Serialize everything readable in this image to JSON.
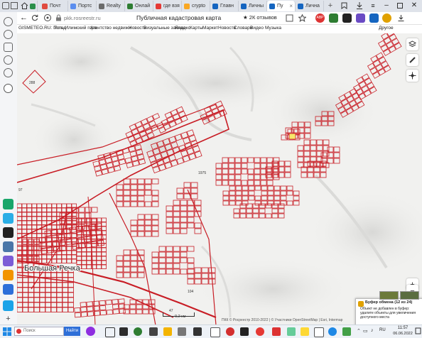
{
  "tabs": [
    {
      "label": "Почт",
      "color": "#e04a3f"
    },
    {
      "label": "Портс",
      "color": "#5b8def"
    },
    {
      "label": "Realty",
      "color": "#6b6b6b"
    },
    {
      "label": "Онлай",
      "color": "#2e7d32"
    },
    {
      "label": "где взя",
      "color": "#e53935"
    },
    {
      "label": "crypto",
      "color": "#f9a825"
    },
    {
      "label": "Главн",
      "color": "#1565c0"
    },
    {
      "label": "Личны",
      "color": "#1565c0"
    },
    {
      "label": "Пу",
      "color": "#1565c0"
    },
    {
      "label": "Лична",
      "color": "#1565c0"
    }
  ],
  "browser": {
    "url": "pkk.rosreestr.ru",
    "page_title": "Публичная кадастровая карта",
    "reviews": "★ 2К отзывов",
    "abp": "ABP"
  },
  "bookmarks": [
    "GISMETEO.RU: Погод",
    "Усть-Илимский горо",
    "Агентство недвижи",
    "Новости",
    "Визуальные заклад",
    "Яндекс",
    "Карты",
    "Маркет",
    "Новости",
    "Словари",
    "Видео",
    "Музыка",
    "Другое"
  ],
  "map": {
    "labels": {
      "town": "Большая Речка",
      "scale": "0,2 км",
      "parcel_288": "288",
      "parcel_1975": "1975",
      "parcel_104": "104",
      "parcel_97": "97",
      "parcel_47": "47",
      "attribution": "ПКК © Росреестр 2010-2022 | © Участники OpenStreetMap | Esri, Intermap"
    },
    "controls": [
      "layers-icon",
      "ruler-icon",
      "locate-icon",
      "zoom-in",
      "zoom-out"
    ],
    "zoom_in": "+",
    "zoom_out": "−"
  },
  "clipboard": {
    "title": "Буфер обмена (12 из 24)",
    "message": "Объект не добавлен в буфер: удалите объекты для увеличения доступного места"
  },
  "taskbar": {
    "search_placeholder": "Поиск",
    "search_button": "Найти",
    "lang": "RU",
    "time": "11:57",
    "date": "06.06.2022"
  }
}
